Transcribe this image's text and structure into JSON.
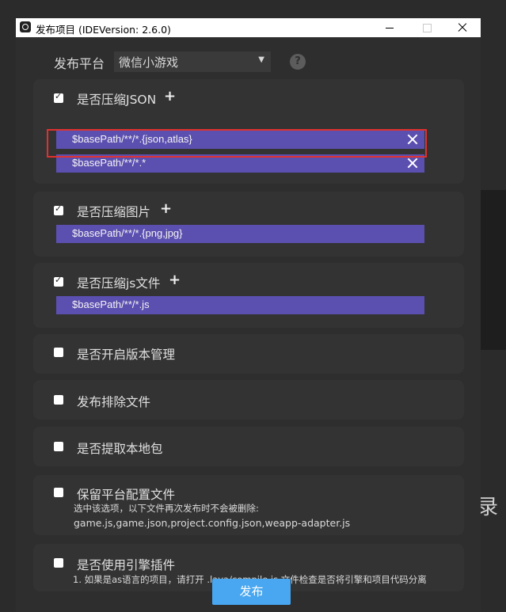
{
  "window": {
    "title": "发布项目 (IDEVersion: 2.6.0)"
  },
  "platform": {
    "label": "发布平台",
    "value": "微信小游戏"
  },
  "sections": [
    {
      "title": "是否压缩JSON",
      "checked": true,
      "patterns": [
        "$basePath/**/*.{json,atlas}",
        "$basePath/**/*.*"
      ]
    },
    {
      "title": "是否压缩图片",
      "checked": true,
      "patterns": [
        "$basePath/**/*.{png,jpg}"
      ]
    },
    {
      "title": "是否压缩js文件",
      "checked": true,
      "patterns": [
        "$basePath/**/*.js"
      ]
    },
    {
      "title": "是否开启版本管理",
      "checked": false
    },
    {
      "title": "发布排除文件",
      "checked": false
    },
    {
      "title": "是否提取本地包",
      "checked": false
    },
    {
      "title": "保留平台配置文件",
      "checked": false,
      "desc": "选中该选项，以下文件再次发布时不会被删除:",
      "desc2": "game.js,game.json,project.config.json,weapp-adapter.js"
    },
    {
      "title": "是否使用引擎插件",
      "checked": false,
      "desc": "1. 如果是as语言的项目，请打开 .laya/compile.js 文件检查是否将引擎和项目代码分离"
    }
  ],
  "publish_button": "发布",
  "background_char": "录"
}
